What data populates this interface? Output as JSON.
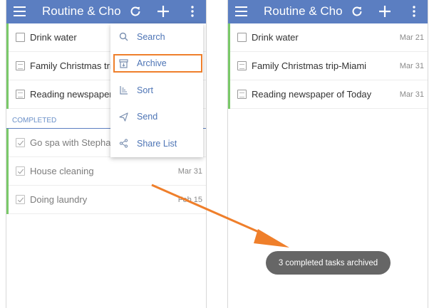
{
  "app": {
    "title": "Routine & Cho...",
    "accent_color": "#5b7ec1",
    "list_bar_color": "#7ac969",
    "highlight_color": "#ef7f2b"
  },
  "left": {
    "tasks": [
      {
        "title": "Drink water",
        "date": ""
      },
      {
        "title": "Family Christmas trip",
        "date": ""
      },
      {
        "title": "Reading newspaper o",
        "date": ""
      }
    ],
    "completed_label": "COMPLETED",
    "completed": [
      {
        "title": "Go spa with Stephan",
        "date": ""
      },
      {
        "title": "House cleaning",
        "date": "Mar 31"
      },
      {
        "title": "Doing laundry",
        "date": "Feb 15"
      }
    ],
    "menu": [
      {
        "label": "Search",
        "icon": "search-icon"
      },
      {
        "label": "Archive",
        "icon": "archive-icon"
      },
      {
        "label": "Sort",
        "icon": "sort-icon"
      },
      {
        "label": "Send",
        "icon": "send-icon"
      },
      {
        "label": "Share List",
        "icon": "share-icon"
      }
    ]
  },
  "right": {
    "tasks": [
      {
        "title": "Drink water",
        "date": "Mar 21"
      },
      {
        "title": "Family Christmas trip-Miami",
        "date": "Mar 31"
      },
      {
        "title": "Reading newspaper of Today",
        "date": "Mar 31"
      }
    ],
    "toast": "3 completed tasks archived"
  }
}
